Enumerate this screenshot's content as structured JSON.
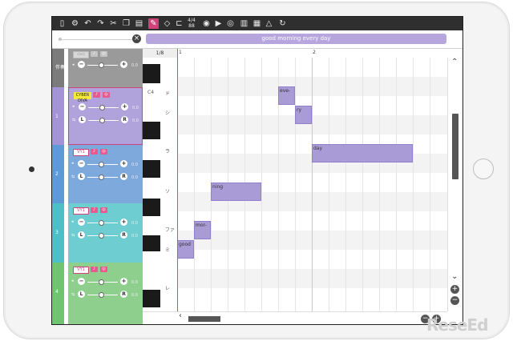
{
  "lyrics": "good morning every day",
  "time_signature": "1/8",
  "toolbar_ratio_top": "4/4",
  "toolbar_ratio_bottom": "88",
  "ruler": [
    "1",
    "2"
  ],
  "key_labels": [
    "C4",
    "ド",
    "シ",
    "ラ",
    "ソ",
    "ファ",
    "ミ",
    "レ"
  ],
  "tracks": [
    {
      "number": "伴奏",
      "vol": "0.0",
      "pan": "",
      "color": "#9a9a9a",
      "stripe": "#7b7b7b"
    },
    {
      "number": "1",
      "instrument": "CYBER DIVA",
      "vol": "0.0",
      "pan": "0.0",
      "color": "#b0a3dc",
      "stripe": "#a493d6"
    },
    {
      "number": "2",
      "instrument": "VY1",
      "vol": "0.0",
      "pan": "0.0",
      "color": "#7ea9dc",
      "stripe": "#5d9ad8"
    },
    {
      "number": "3",
      "instrument": "VY1",
      "vol": "0.0",
      "pan": "0.0",
      "color": "#6ecdd0",
      "stripe": "#4ebfc6"
    },
    {
      "number": "4",
      "instrument": "VY1",
      "vol": "0.0",
      "pan": "0.0",
      "color": "#8ecf8e",
      "stripe": "#6fc46f"
    }
  ],
  "notes": [
    {
      "text": "eve-"
    },
    {
      "text": "ry"
    },
    {
      "text": "day"
    },
    {
      "text": "ning"
    },
    {
      "text": "mor-"
    },
    {
      "text": "good"
    }
  ],
  "colors": {
    "accent": "#d0437a",
    "note": "#a89bd6",
    "lyric_bar": "#b7a6dd"
  },
  "watermark": "ReseEd"
}
